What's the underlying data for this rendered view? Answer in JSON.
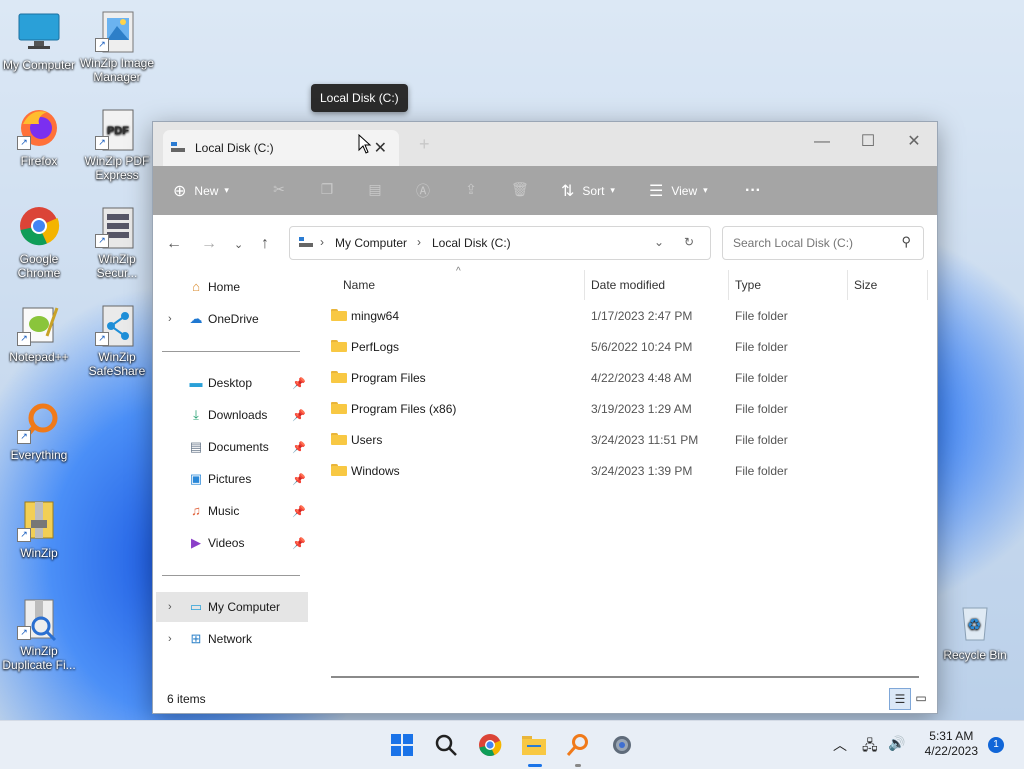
{
  "desktop": {
    "icons": [
      {
        "label": "My Computer"
      },
      {
        "label": "WinZip Image Manager"
      },
      {
        "label": "Firefox"
      },
      {
        "label": "WinZip PDF Express"
      },
      {
        "label": "Google Chrome"
      },
      {
        "label": "WinZip Secur..."
      },
      {
        "label": "Notepad++"
      },
      {
        "label": "WinZip SafeShare"
      },
      {
        "label": "Everything"
      },
      {
        "label": "WinZip"
      },
      {
        "label": "WinZip Duplicate Fi..."
      },
      {
        "label": "Recycle Bin"
      }
    ]
  },
  "tooltip": {
    "text": "Local Disk (C:)"
  },
  "window": {
    "tab_title": "Local Disk (C:)",
    "toolbar": {
      "new_label": "New",
      "sort_label": "Sort",
      "view_label": "View",
      "more_label": "···"
    },
    "address": {
      "crumbs": [
        "My Computer",
        "Local Disk (C:)"
      ]
    },
    "search": {
      "placeholder": "Search Local Disk (C:)"
    },
    "sidebar": {
      "home": "Home",
      "onedrive": "OneDrive",
      "quick": [
        "Desktop",
        "Downloads",
        "Documents",
        "Pictures",
        "Music",
        "Videos"
      ],
      "my_computer": "My Computer",
      "network": "Network"
    },
    "columns": {
      "name": "Name",
      "date": "Date modified",
      "type": "Type",
      "size": "Size"
    },
    "files": [
      {
        "name": "mingw64",
        "date": "1/17/2023 2:47 PM",
        "type": "File folder"
      },
      {
        "name": "PerfLogs",
        "date": "5/6/2022 10:24 PM",
        "type": "File folder"
      },
      {
        "name": "Program Files",
        "date": "4/22/2023 4:48 AM",
        "type": "File folder"
      },
      {
        "name": "Program Files (x86)",
        "date": "3/19/2023 1:29 AM",
        "type": "File folder"
      },
      {
        "name": "Users",
        "date": "3/24/2023 11:51 PM",
        "type": "File folder"
      },
      {
        "name": "Windows",
        "date": "3/24/2023 1:39 PM",
        "type": "File folder"
      }
    ],
    "status": {
      "count": "6 items"
    }
  },
  "taskbar": {
    "time": "5:31 AM",
    "date": "4/22/2023",
    "notifications": "1"
  }
}
